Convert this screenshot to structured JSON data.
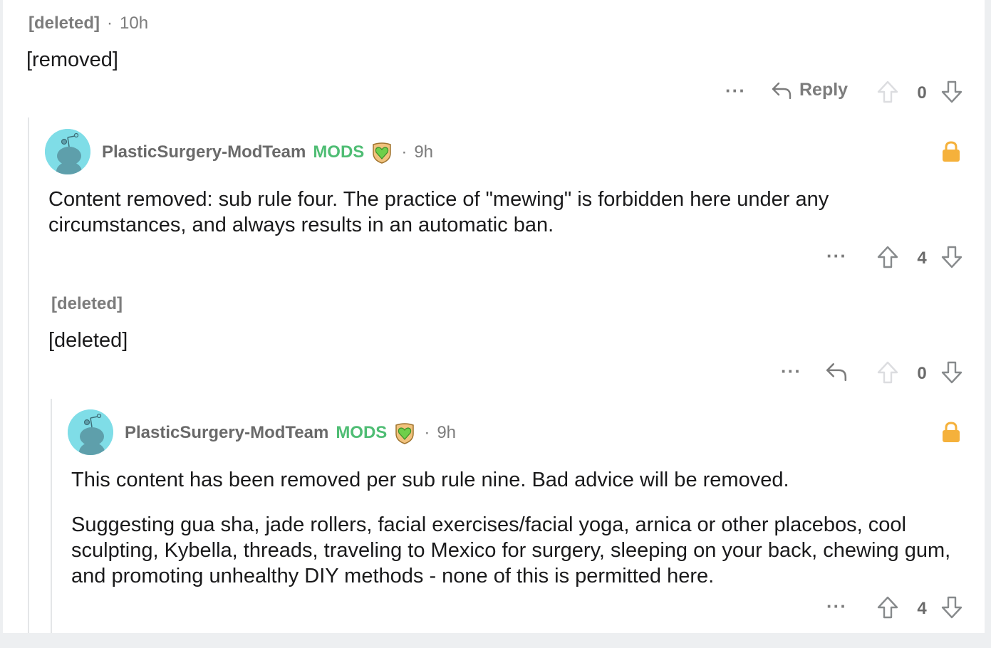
{
  "comment1": {
    "author": "[deleted]",
    "time": "10h",
    "body": "[removed]",
    "reply_label": "Reply",
    "votes": "0"
  },
  "comment2": {
    "author": "PlasticSurgery-ModTeam",
    "flair": "MODS",
    "time": "9h",
    "body": "Content removed: sub rule four. The practice of \"mewing\" is forbidden here under any circumstances, and always results in an automatic ban.",
    "votes": "4"
  },
  "comment3": {
    "author": "[deleted]",
    "body": "[deleted]",
    "votes": "0"
  },
  "comment4": {
    "author": "PlasticSurgery-ModTeam",
    "flair": "MODS",
    "time": "9h",
    "body_p1": "This content has been removed per sub rule nine. Bad advice will be removed.",
    "body_p2": "Suggesting gua sha, jade rollers, facial exercises/facial yoga, arnica or other placebos, cool sculpting, Kybella, threads, traveling to Mexico for surgery, sleeping on your back, chewing gum, and promoting unhealthy DIY methods - none of this is permitted here.",
    "votes": "4"
  },
  "common": {
    "separator": "·",
    "more_label": "···"
  },
  "colors": {
    "mod_green": "#4fbd74",
    "lock_orange": "#f5b13b",
    "avatar_bg": "#7fdde7",
    "snoo_body": "#5e9fab"
  },
  "icons": [
    "reply-arrow-icon",
    "upvote-arrow-icon",
    "downvote-arrow-icon",
    "lock-icon",
    "snoo-avatar-icon",
    "mod-heart-badge-icon",
    "more-options-icon"
  ]
}
